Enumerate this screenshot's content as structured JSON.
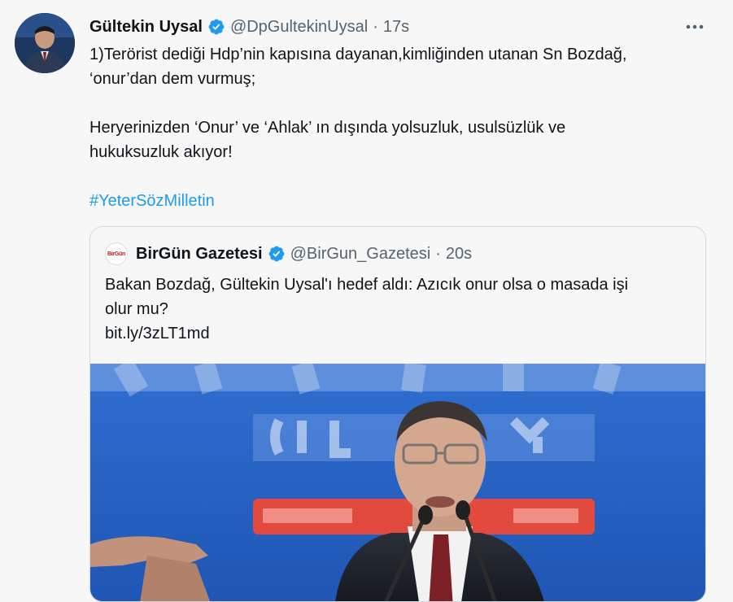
{
  "tweet": {
    "author_name": "Gültekin Uysal",
    "handle": "@DpGultekinUysal",
    "separator": "·",
    "time": "17s",
    "line1": "1)Terörist dediği Hdp’nin kapısına dayanan,kimliğinden utanan Sn Bozdağ,",
    "line2": "‘onur’dan dem vurmuş;",
    "line3": "Heryerinizden ‘Onur’ ve ‘Ahlak’ ın dışında yolsuzluk, usulsüzlük ve",
    "line4": "hukuksuzluk akıyor!",
    "hashtag": "#YeterSözMilletin"
  },
  "quote": {
    "author_name": "BirGün Gazetesi",
    "handle": "@BirGun_Gazetesi",
    "separator": "·",
    "time": "20s",
    "logo_text": "BirGün",
    "line1": "Bakan Bozdağ, Gültekin Uysal'ı hedef aldı: Azıcık onur olsa o masada işi",
    "line2": "olur mu?",
    "link": "bit.ly/3zLT1md"
  },
  "colors": {
    "accent": "#1d9bf0",
    "text": "#0f1419",
    "muted": "#536471"
  }
}
